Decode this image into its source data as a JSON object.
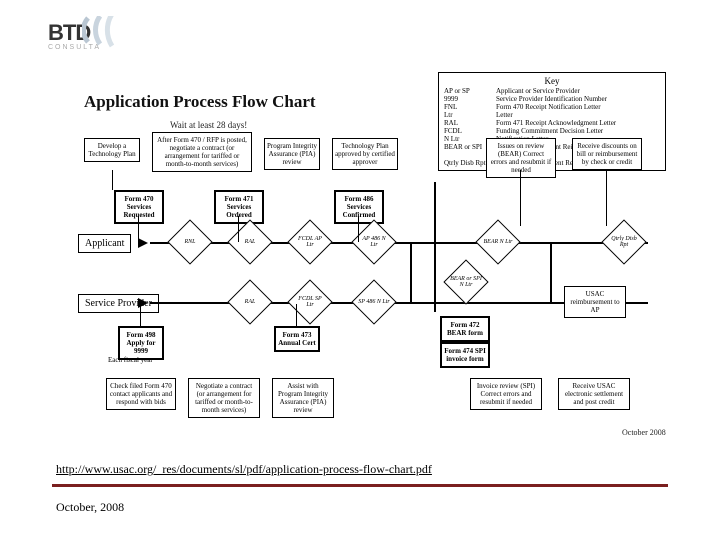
{
  "logo": {
    "text": "BTD",
    "sub": "CONSULTA"
  },
  "title": "Application Process Flow Chart",
  "wait_text": "Wait at least 28 days!",
  "key": {
    "title": "Key",
    "rows": [
      {
        "abbr": "AP or SP",
        "def": "Applicant or Service Provider"
      },
      {
        "abbr": "9999",
        "def": "Service Provider Identification Number"
      },
      {
        "abbr": "FNL",
        "def": "Form 470 Receipt Notification Letter"
      },
      {
        "abbr": "Ltr",
        "def": "Letter"
      },
      {
        "abbr": "RAL",
        "def": "Form 471 Receipt Acknowledgment Letter"
      },
      {
        "abbr": "FCDL",
        "def": "Funding Commitment Decision Letter"
      },
      {
        "abbr": "N Ltr",
        "def": "Notification Letter"
      },
      {
        "abbr": "BEAR or SPI",
        "def": "Billed Entity Applicant Reimbursement or Service Provider Invoice"
      },
      {
        "abbr": "Qtrly Disb Rpt",
        "def": "Quarterly Disbursement Report"
      }
    ]
  },
  "roles": {
    "applicant": "Applicant",
    "sp": "Service Provider"
  },
  "top_boxes": [
    "Develop a Technology Plan",
    "After Form 470 / RFP is posted, negotiate a contract (or arrangement for tariffed or month-to-month services)",
    "Program Integrity Assurance (PIA) review",
    "Technology Plan approved by certified approver",
    "Issues on review (BEAR) Correct errors and resubmit if needed",
    "Receive discounts on bill or reimbursement by check or credit"
  ],
  "mid_forms": [
    "Form 470 Services Requested",
    "Form 471 Services Ordered",
    "Form 486 Services Confirmed"
  ],
  "diamonds_top": [
    "RNL",
    "RAL",
    "FCDL AP Ltr",
    "AP 486 N Ltr",
    "BEAR N Ltr",
    "Qtrly Disb Rpt"
  ],
  "diamonds_bot": [
    "RAL",
    "FCDL SP Ltr",
    "SP 486 N Ltr",
    "BEAR or SPI N Ltr"
  ],
  "sp_forms": [
    "Form 498 Apply for 9999",
    "Form 473 Annual Cert",
    "Form 472 BEAR form",
    "Form 474 SPI invoice form"
  ],
  "usac_box": "USAC reimbursement to AP",
  "bottom_boxes": [
    "Check filed Form 470 contact applicants and respond with bids",
    "Negotiate a contract (or arrangement for tariffed or month-to-month services)",
    "Assist with Program Integrity Assurance (PIA) review",
    "Invoice review (SPI) Correct errors and resubmit if needed",
    "Receive USAC electronic settlement and post credit"
  ],
  "brackets": {
    "label": "Each fiscal year"
  },
  "footer_link": "http://www.usac.org/_res/documents/sl/pdf/application-process-flow-chart.pdf",
  "footer_date": "October, 2008",
  "date_small": "October 2008"
}
